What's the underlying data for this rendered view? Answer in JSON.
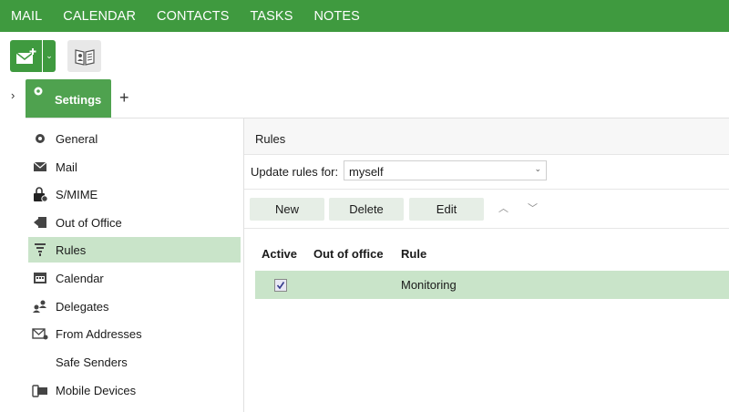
{
  "topnav": {
    "items": [
      "MAIL",
      "CALENDAR",
      "CONTACTS",
      "TASKS",
      "NOTES"
    ]
  },
  "tabs": {
    "settings_label": "Settings",
    "add_symbol": "+",
    "expand_symbol": "›"
  },
  "sidebar": {
    "items": [
      {
        "label": "General",
        "icon": "gear-icon"
      },
      {
        "label": "Mail",
        "icon": "envelope-icon"
      },
      {
        "label": "S/MIME",
        "icon": "lock-icon"
      },
      {
        "label": "Out of Office",
        "icon": "out-of-office-icon"
      },
      {
        "label": "Rules",
        "icon": "funnel-icon",
        "active": true
      },
      {
        "label": "Calendar",
        "icon": "calendar-icon"
      },
      {
        "label": "Delegates",
        "icon": "delegates-icon"
      },
      {
        "label": "From Addresses",
        "icon": "from-address-icon"
      },
      {
        "label": "Safe Senders",
        "icon": ""
      },
      {
        "label": "Mobile Devices",
        "icon": "mobile-devices-icon"
      }
    ]
  },
  "main": {
    "title": "Rules",
    "update_label": "Update rules for:",
    "update_value": "myself",
    "buttons": {
      "new": "New",
      "delete": "Delete",
      "edit": "Edit"
    },
    "columns": {
      "active": "Active",
      "out_of_office": "Out of office",
      "rule": "Rule"
    },
    "rows": [
      {
        "active": true,
        "out_of_office": "",
        "rule": "Monitoring"
      }
    ]
  },
  "colors": {
    "brand_green": "#3f9a3f",
    "selection_green": "#c9e4c9"
  }
}
